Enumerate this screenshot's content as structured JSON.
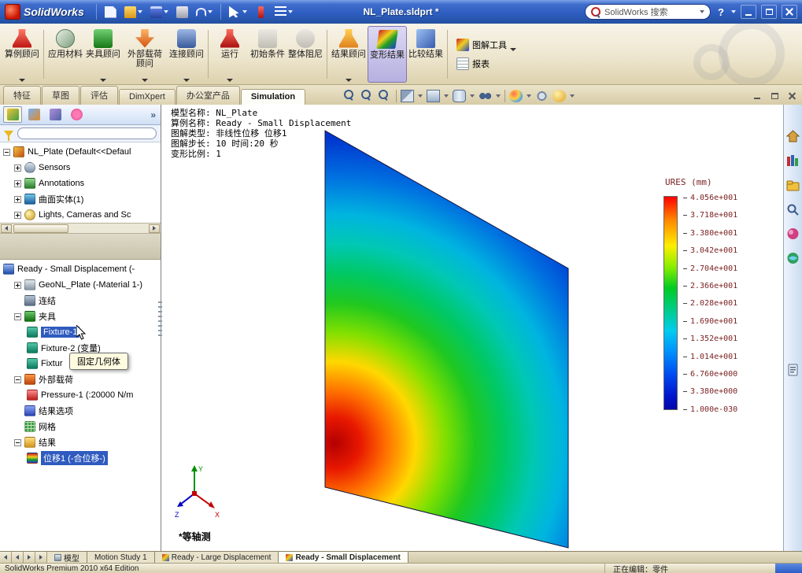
{
  "glyphs": {
    "help": "?",
    "panel_chevrons": "»"
  },
  "titlebar": {
    "app_name": "SolidWorks",
    "document_title": "NL_Plate.sldprt *",
    "search_text": "SolidWorks 搜索"
  },
  "ribbon": {
    "buttons": [
      {
        "label": "算例顾问"
      },
      {
        "label": "应用材料"
      },
      {
        "label": "夹具顾问"
      },
      {
        "label": "外部载荷顾问"
      },
      {
        "label": "连接顾问"
      },
      {
        "label": "运行"
      },
      {
        "label": "初始条件"
      },
      {
        "label": "整体阻尼"
      },
      {
        "label": "结果顾问"
      },
      {
        "label": "变形结果"
      },
      {
        "label": "比较结果"
      }
    ],
    "tool_buttons": [
      {
        "label": "图解工具"
      },
      {
        "label": "报表"
      }
    ]
  },
  "command_tabs": {
    "tabs": [
      {
        "label": "特征"
      },
      {
        "label": "草图"
      },
      {
        "label": "评估"
      },
      {
        "label": "DimXpert"
      },
      {
        "label": "办公室产品"
      },
      {
        "label": "Simulation"
      }
    ]
  },
  "feature_tree": {
    "root_label": "NL_Plate (Default<<Defaul",
    "items": [
      {
        "label": "Sensors"
      },
      {
        "label": "Annotations"
      },
      {
        "label": "曲面实体(1)"
      },
      {
        "label": "Lights, Cameras and Sc"
      }
    ]
  },
  "study_tree": {
    "root_label": "Ready - Small Displacement (-",
    "items": [
      {
        "label": "GeoNL_Plate (-Material 1-)"
      },
      {
        "label": "连结"
      },
      {
        "label": "夹具"
      },
      {
        "label": "Fixture-1"
      },
      {
        "label": "Fixture-2 (变量)"
      },
      {
        "label": "Fixtur"
      },
      {
        "label": "外部载荷"
      },
      {
        "label": "Pressure-1 (:20000 N/m"
      },
      {
        "label": "结果选项"
      },
      {
        "label": "网格"
      },
      {
        "label": "结果"
      },
      {
        "label": "位移1 (-合位移-)"
      }
    ],
    "tooltip": "固定几何体"
  },
  "viewport": {
    "info_lines": [
      "模型名称: NL_Plate",
      "算例名称: Ready - Small Displacement",
      "图解类型: 非线性位移 位移1",
      "图解步长: 10  时间:20 秒",
      "变形比例: 1"
    ],
    "view_orientation_label": "*等轴测",
    "legend": {
      "title": "URES (mm)",
      "values": [
        "4.056e+001",
        "3.718e+001",
        "3.380e+001",
        "3.042e+001",
        "2.704e+001",
        "2.366e+001",
        "2.028e+001",
        "1.690e+001",
        "1.352e+001",
        "1.014e+001",
        "6.760e+000",
        "3.380e+000",
        "1.000e-030"
      ]
    },
    "triad": {
      "x": "X",
      "y": "Y",
      "z": "Z"
    }
  },
  "bottom_tabs": {
    "tabs": [
      {
        "label": "模型"
      },
      {
        "label": "Motion Study 1"
      },
      {
        "label": "Ready - Large Displacement"
      },
      {
        "label": "Ready - Small Displacement"
      }
    ]
  },
  "statusbar": {
    "left_text": "SolidWorks Premium 2010 x64 Edition",
    "right_text": "正在编辑：零件"
  }
}
